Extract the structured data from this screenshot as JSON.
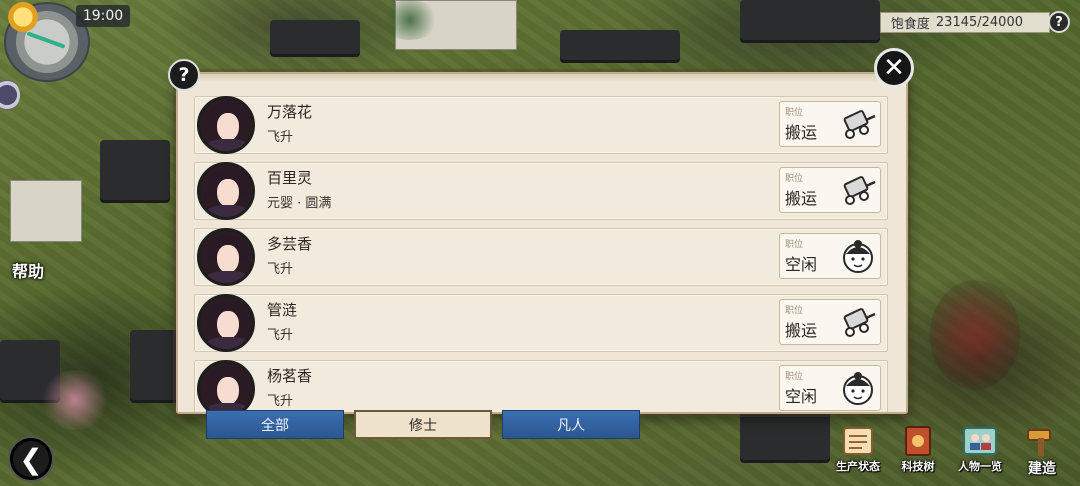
{
  "hud": {
    "time": "19:00",
    "help_side_label": "帮助",
    "satiety_label": "饱食度",
    "satiety_value": "23145/24000",
    "satiety_fraction": 0.964
  },
  "panel": {
    "help_symbol": "?",
    "close_symbol": "✕",
    "job_label": "职位",
    "roster": [
      {
        "name": "万落花",
        "realm": "飞升",
        "job": "搬运",
        "job_icon": "cart-icon"
      },
      {
        "name": "百里灵",
        "realm": "元婴 · 圆满",
        "job": "搬运",
        "job_icon": "cart-icon"
      },
      {
        "name": "多芸香",
        "realm": "飞升",
        "job": "空闲",
        "job_icon": "idle-face-icon"
      },
      {
        "name": "管涟",
        "realm": "飞升",
        "job": "搬运",
        "job_icon": "cart-icon"
      },
      {
        "name": "杨茗香",
        "realm": "飞升",
        "job": "空闲",
        "job_icon": "idle-face-icon"
      }
    ]
  },
  "tabs": {
    "all": "全部",
    "cultivator": "修士",
    "mortal": "凡人",
    "active": "cultivator"
  },
  "menu": {
    "production": "生产状态",
    "tech_tree": "科技树",
    "characters": "人物一览",
    "build": "建造"
  },
  "colors": {
    "tab_blue": "#2f5f9e",
    "panel_bg": "#efe6d7",
    "satiety_bg": "#eee8da"
  }
}
